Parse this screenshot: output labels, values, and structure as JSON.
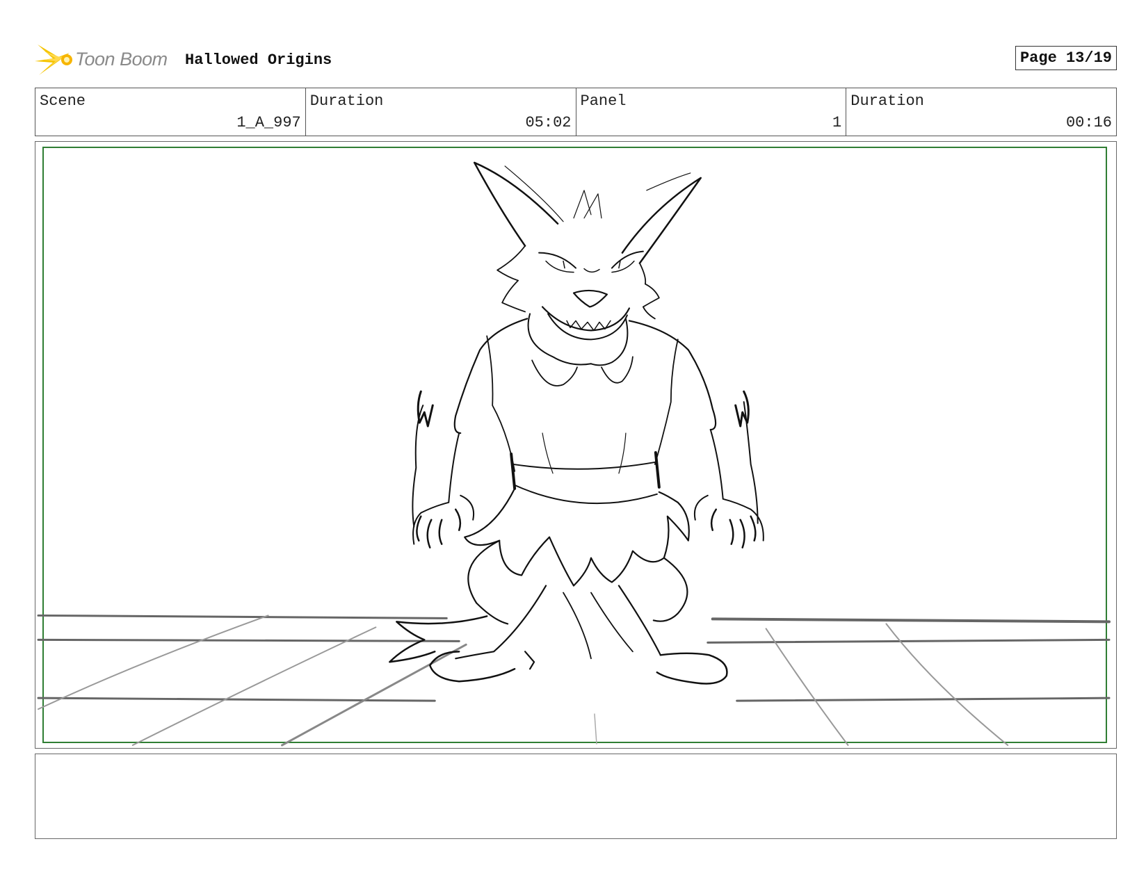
{
  "header": {
    "logo_text": "Toon Boom",
    "project_title": "Hallowed Origins",
    "page_label": "Page 13/19"
  },
  "info": {
    "scene_label": "Scene",
    "scene_value": "1_A_997",
    "duration_label": "Duration",
    "duration_value": "05:02",
    "panel_label": "Panel",
    "panel_value": "1",
    "panel_duration_label": "Duration",
    "panel_duration_value": "00:16"
  },
  "colors": {
    "safe_frame": "#2e7d32",
    "logo_flame": "#f5c400"
  },
  "icons": {
    "logo": "toon-boom-flame-icon"
  },
  "notes": {
    "text": ""
  }
}
